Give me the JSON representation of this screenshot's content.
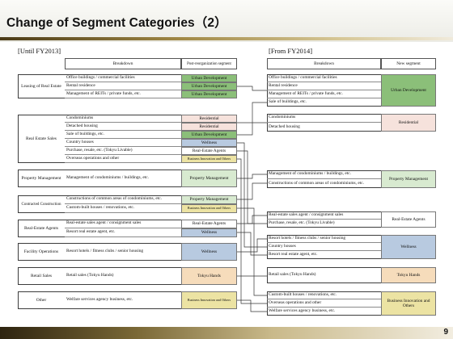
{
  "title": "Change of Segment Categories（2）",
  "left": {
    "period": "[Until FY2013]",
    "headers": {
      "breakdown": "Breakdown",
      "segment": "Post-reorganization segment"
    },
    "groups": [
      {
        "category": "Leasing of Real Estate",
        "rows": [
          {
            "item": "Office buildings / commercial facilities",
            "segment": "Urban Development"
          },
          {
            "item": "Rental residence",
            "segment": "Urban Development"
          },
          {
            "item": "Management of REITs / private funds, etc.",
            "segment": "Urban Development"
          }
        ]
      },
      {
        "category": "Real Estate Sales",
        "rows": [
          {
            "item": "Condominiums",
            "segment": "Residential"
          },
          {
            "item": "Detached housing",
            "segment": "Residential"
          },
          {
            "item": "Sale of buildings, etc.",
            "segment": "Urban Development"
          },
          {
            "item": "Country houses",
            "segment": "Wellness"
          },
          {
            "item": "Purchase, resale, etc. (Tokyu Livable)",
            "segment": "Real-Estate Agents"
          },
          {
            "item": "Overseas operations and other",
            "segment": "Business Innovation and Others"
          }
        ]
      },
      {
        "category": "Property Management",
        "rows": [
          {
            "item": "Management of condominiums / buildings, etc.",
            "segment": "Property Management"
          }
        ]
      },
      {
        "category": "Contracted Construction",
        "rows": [
          {
            "item": "Constructions of common areas of condominiums, etc.",
            "segment": "Property Management"
          },
          {
            "item": "Custom-built houses / renovations, etc.",
            "segment": "Business Innovation and Others"
          }
        ]
      },
      {
        "category": "Real-Estate Agents",
        "rows": [
          {
            "item": "Real-estate sales agent / consignment sales",
            "segment": "Real-Estate Agents"
          },
          {
            "item": "Resort real estate agent, etc.",
            "segment": "Wellness"
          }
        ]
      },
      {
        "category": "Facility Operations",
        "rows": [
          {
            "item": "Resort hotels / fitness clubs / senior housing",
            "segment": "Wellness"
          }
        ]
      },
      {
        "category": "Retail Sales",
        "rows": [
          {
            "item": "Retail sales (Tokyu Hands)",
            "segment": "Tokyu Hands"
          }
        ]
      },
      {
        "category": "Other",
        "rows": [
          {
            "item": "Welfare services agency business, etc.",
            "segment": "Business Innovation and Others"
          }
        ]
      }
    ]
  },
  "right": {
    "period": "[From FY2014]",
    "headers": {
      "breakdown": "Breakdown",
      "segment": "New segment"
    },
    "groups": [
      {
        "segment": "Urban Development",
        "items": [
          "Office buildings / commercial facilities",
          "Rental residence",
          "Management of REITs / private funds, etc.",
          "Sale of buildings, etc."
        ]
      },
      {
        "segment": "Residential",
        "items": [
          "Condominiums",
          "Detached housing"
        ]
      },
      {
        "segment": "Property Management",
        "items": [
          "Management of condominiums / buildings, etc.",
          "Constructions of common areas of condominiums, etc."
        ]
      },
      {
        "segment": "Real-Estate Agents",
        "items": [
          "Real-estate sales agent / consignment sales",
          "Purchase, resale, etc. (Tokyu Livable)"
        ]
      },
      {
        "segment": "Wellness",
        "items": [
          "Resort hotels / fitness clubs / senior housing",
          "Country houses",
          "Resort real estate agent, etc."
        ]
      },
      {
        "segment": "Tokyu Hands",
        "items": [
          "Retail sales (Tokyu Hands)"
        ]
      },
      {
        "segment": "Business Innovation and Others",
        "items": [
          "Custom-built houses / renovations, etc.",
          "Overseas operations and other",
          "Welfare services agency business, etc."
        ]
      }
    ]
  },
  "page_number": "9",
  "colors": {
    "urban_development": "#8bbf79",
    "property_management": "#d8ead0",
    "residential": "#f6e2dc",
    "wellness": "#b8cae0",
    "tokyu_hands": "#f6dcbb",
    "business_innovation": "#ece3a3",
    "title_rule": "#a08845"
  }
}
